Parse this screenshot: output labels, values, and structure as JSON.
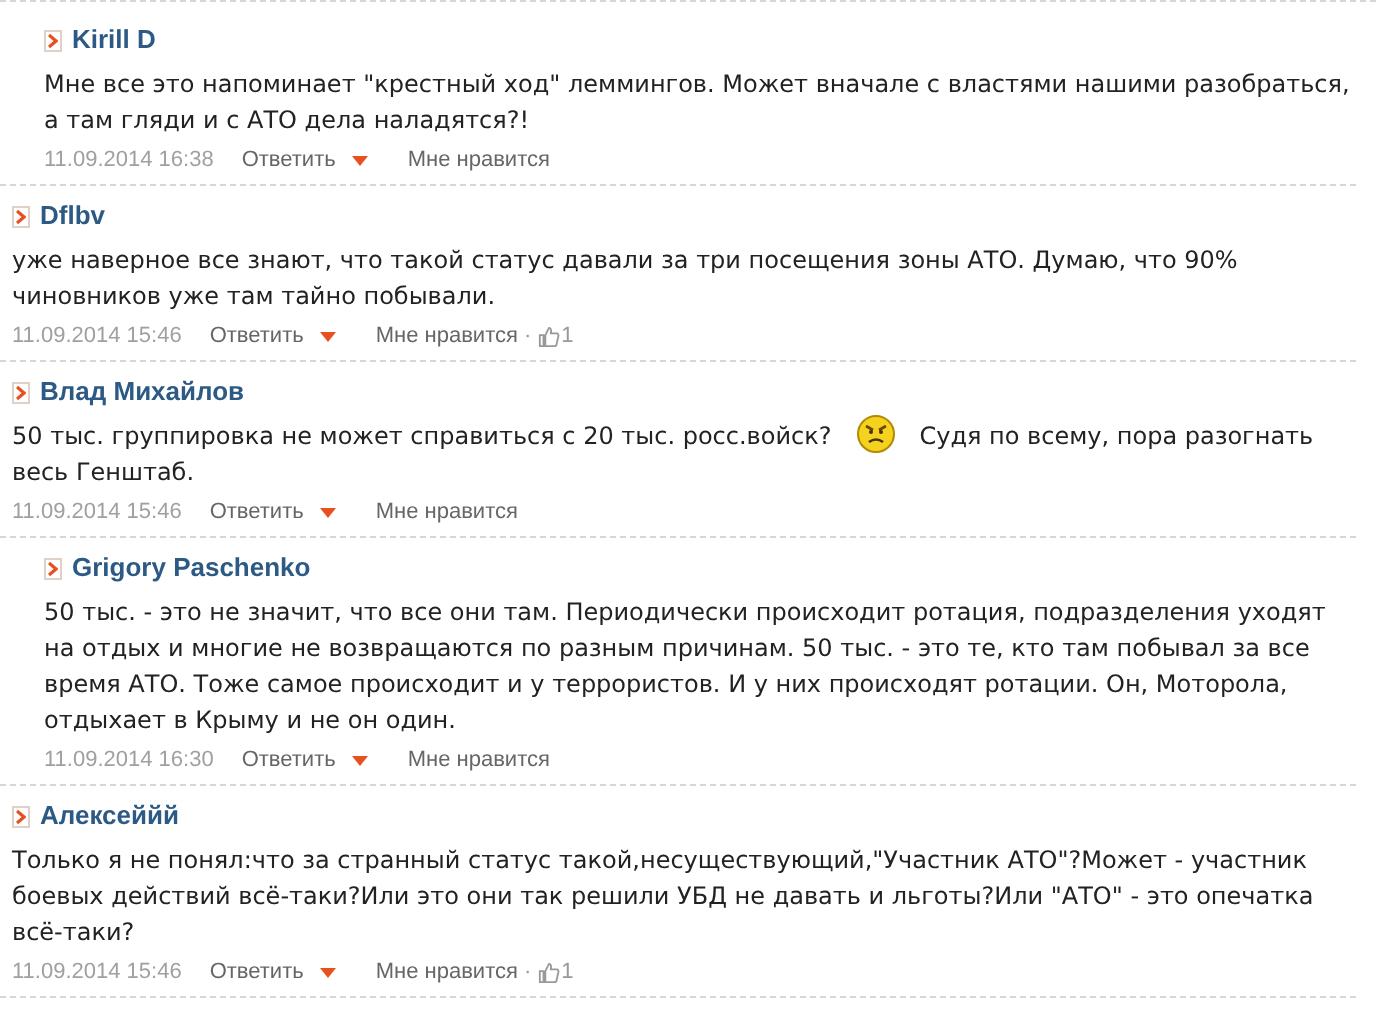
{
  "comments": [
    {
      "author": "Kirill D",
      "is_reply": true,
      "body": [
        {
          "kind": "text",
          "text": "Мне все это напоминает \"крестный ход\" леммингов. Может вначале с властями нашими разобраться, а там гляди и с АТО дела наладятся?!"
        }
      ],
      "date": "11.09.2014 16:38",
      "reply_label": "Ответить",
      "like_label": "Мне нравится"
    },
    {
      "author": "Dflbv",
      "is_reply": false,
      "body": [
        {
          "kind": "text",
          "text": "уже наверное все знают, что такой статус давали за три посещения зоны АТО. Думаю, что 90% чиновников уже там тайно побывали."
        }
      ],
      "date": "11.09.2014 15:46",
      "reply_label": "Ответить",
      "like_label": "Мне нравится",
      "like_separator": "·",
      "like_count": "1"
    },
    {
      "author": "Влад Михайлов",
      "is_reply": false,
      "body": [
        {
          "kind": "text",
          "text": "50 тыс. группировка не может справиться с 20 тыс. росс.войск?"
        },
        {
          "kind": "smiley"
        },
        {
          "kind": "text",
          "text": "Судя по всему, пора разогнать весь Генштаб."
        }
      ],
      "date": "11.09.2014 15:46",
      "reply_label": "Ответить",
      "like_label": "Мне нравится",
      "children": [
        {
          "author": "Grigory Paschenko",
          "is_reply": true,
          "body": [
            {
              "kind": "text",
              "text": "50 тыс. - это не значит, что все они там. Периодически происходит ротация, подразделения уходят на отдых и многие не возвращаются по разным причинам. 50 тыс. - это те, кто там побывал за все время АТО. Тоже самое происходит и у террористов. И у них происходят ротации. Он, Моторола, отдыхает в Крыму и не он один."
            }
          ],
          "date": "11.09.2014 16:30",
          "reply_label": "Ответить",
          "like_label": "Мне нравится"
        }
      ]
    },
    {
      "author": "Алексеййй",
      "is_reply": false,
      "body": [
        {
          "kind": "text",
          "text": "Только я не понял:что за странный статус такой,несуществующий,\"Участник АТО\"?Может - участник боевых действий всё-таки?Или это они так решили УБД не давать и льготы?Или \"АТО\" - это опечатка всё-таки?"
        }
      ],
      "date": "11.09.2014 15:46",
      "reply_label": "Ответить",
      "like_label": "Мне нравится",
      "like_separator": "·",
      "like_count": "1"
    }
  ]
}
